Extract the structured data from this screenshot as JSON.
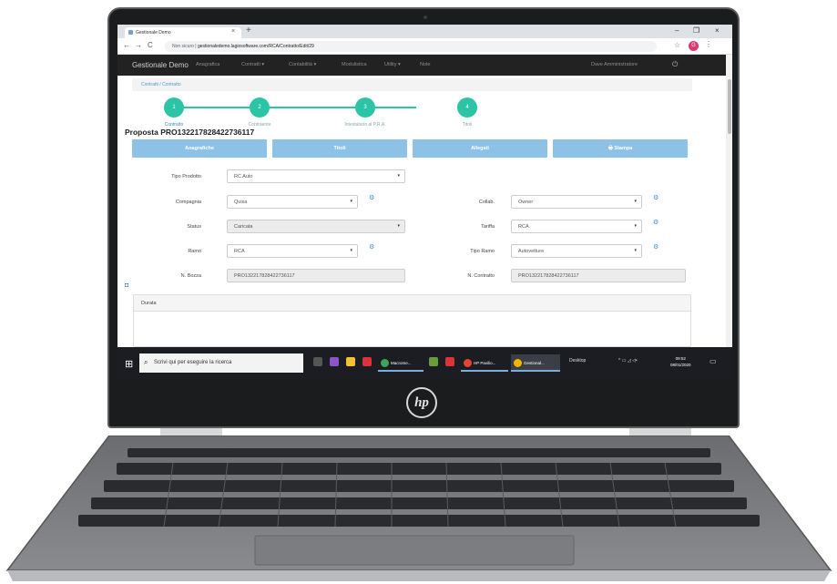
{
  "browser": {
    "tab_title": "Gestionale Demo",
    "tab_close": "×",
    "tab_new": "+",
    "url_prefix": "Non sicuro | ",
    "url": "gestionaledemo.lagiosoftware.com/RCA/Contratto/Edit/29",
    "win_min": "–",
    "win_max": "❐",
    "win_close": "×",
    "profile_initial": "G",
    "nav_back": "←",
    "nav_forward": "→",
    "nav_reload": "C",
    "star": "☆",
    "kebab": "⋮"
  },
  "app": {
    "brand": "Gestionale Demo",
    "nav_items": [
      "Anagrafica",
      "Contratti ▾",
      "Contabilità ▾",
      "Modulistica",
      "Utility ▾",
      "Note"
    ],
    "user": "Dave Amministratore",
    "exit_icon": "⏻",
    "breadcrumb": "Contratti  /  Contratto"
  },
  "steps": [
    {
      "num": "1",
      "label": "Contratto",
      "active": true
    },
    {
      "num": "2",
      "label": "Contraente",
      "active": false
    },
    {
      "num": "3",
      "label": "Intestatario al P.R.A.",
      "active": false
    },
    {
      "num": "4",
      "label": "Titoli",
      "active": false
    }
  ],
  "proposal_title": "Proposta PRO132217828422736117",
  "action_buttons": [
    "Anagrafiche",
    "Titoli",
    "Allegati",
    "🖶 Stampa"
  ],
  "form_left": [
    {
      "label": "Tipo Prodotto",
      "value": "RC Auto",
      "readonly": false,
      "gear": false
    },
    {
      "label": "Compagnia",
      "value": "Quixa",
      "readonly": false,
      "gear": true
    },
    {
      "label": "Status",
      "value": "Caricata",
      "readonly": true,
      "gear": false
    },
    {
      "label": "Ramo",
      "value": "RCA",
      "readonly": false,
      "gear": true
    },
    {
      "label": "N. Bozza",
      "value": "PRO132217828422736117",
      "readonly": true,
      "gear": false
    }
  ],
  "form_right": [
    {
      "label": "Collab.",
      "value": "Owner",
      "readonly": false
    },
    {
      "label": "Tariffa",
      "value": "RCA",
      "readonly": false
    },
    {
      "label": "Tipo Ramo",
      "value": "Autovetture",
      "readonly": false
    },
    {
      "label": "N. Contratto",
      "value": "PRO132217828422736117",
      "readonly": true
    }
  ],
  "panel": {
    "title": "Durata"
  },
  "taskbar": {
    "search_placeholder": "Scrivi qui per eseguire la ricerca",
    "apps": [
      {
        "label": "Macrome...",
        "color": "#3aa55b"
      },
      {
        "label": "HP Pavilio...",
        "color": "#e94235"
      },
      {
        "label": "Gestional...",
        "color": "#f2b600"
      }
    ],
    "desktop_label": "Desktop",
    "time": "09:52",
    "date": "08/01/2020"
  },
  "device": {
    "brand_logo": "hp"
  },
  "colors": {
    "accent": "#2bc5a5",
    "button": "#8ec1e6",
    "navbar": "#222222"
  }
}
